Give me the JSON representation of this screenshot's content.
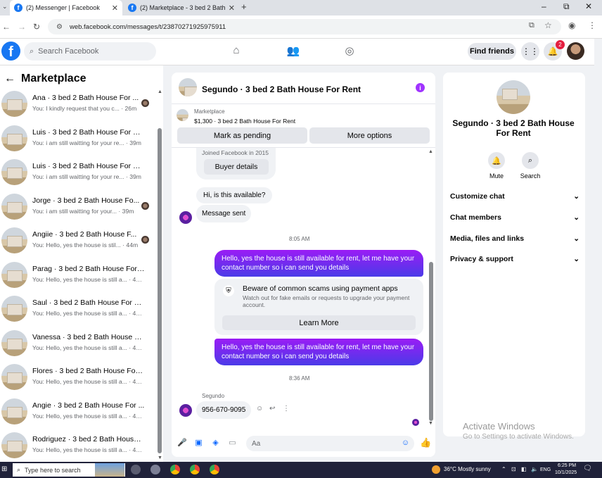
{
  "browser": {
    "tabs": [
      {
        "title": "(2) Messenger | Facebook",
        "active": true
      },
      {
        "title": "(2) Marketplace - 3 bed 2 Bath",
        "active": false
      }
    ],
    "url": "web.facebook.com/messages/t/23870271925975911",
    "window_controls": {
      "minimize": "–",
      "restore": "⧉",
      "close": "✕"
    }
  },
  "header": {
    "logo": "f",
    "search_placeholder": "Search Facebook",
    "find_friends_label": "Find friends",
    "notifications_count": "2"
  },
  "sidebar": {
    "title": "Marketplace",
    "conversations": [
      {
        "name": "Ana · 3 bed 2 Bath House For ...",
        "preview": "You: I kindly request that you c... · 26m"
      },
      {
        "name": "Luis · 3 bed 2 Bath House For Re...",
        "preview": "You: i am still waitting for your re... · 39m"
      },
      {
        "name": "Luis · 3 bed 2 Bath House For Re...",
        "preview": "You: i am still waitting for your re... · 39m"
      },
      {
        "name": "Jorge · 3 bed 2 Bath House Fo...",
        "preview": "You: i am still waitting for your... · 39m"
      },
      {
        "name": "Angiie · 3 bed 2 Bath House F...",
        "preview": "You: Hello, yes the house is stil... · 44m"
      },
      {
        "name": "Parag · 3 bed 2 Bath House For ...",
        "preview": "You: Hello, yes the house is still a... · 47m"
      },
      {
        "name": "Saul · 3 bed 2 Bath House For R...",
        "preview": "You: Hello, yes the house is still a... · 47m"
      },
      {
        "name": "Vanessa · 3 bed 2 Bath House Fo...",
        "preview": "You: Hello, yes the house is still a... · 47m"
      },
      {
        "name": "Flores · 3 bed 2 Bath House For ...",
        "preview": "You: Hello, yes the house is still a... · 47m"
      },
      {
        "name": "Angie · 3 bed 2 Bath House For ...",
        "preview": "You: Hello, yes the house is still a... · 47m"
      },
      {
        "name": "Rodriguez · 3 bed 2 Bath House ...",
        "preview": "You: Hello, yes the house is still a... · 48m"
      }
    ]
  },
  "chat": {
    "title": "Segundo · 3 bed 2 Bath House For Rent",
    "marketplace_label": "Marketplace",
    "listing": "$1,300 · 3 bed 2 Bath House For Rent",
    "mark_pending_label": "Mark as pending",
    "more_options_label": "More options",
    "joined_text": "Joined Facebook in 2015",
    "buyer_details_label": "Buyer details",
    "msg_available": "Hi, is this available?",
    "msg_sent": "Message sent",
    "time1": "8:05 AM",
    "reply1": "Hello, yes the house is still available for rent, let me have your contact number so i can send you  details",
    "scam_title": "Beware of common scams using payment apps",
    "scam_text": "Watch out for fake emails or requests to upgrade your payment account.",
    "learn_more_label": "Learn More",
    "reply2": "Hello, yes the house is still available for rent, let me have your contact number so i can send you  details",
    "time2": "8:36 AM",
    "sender_name": "Segundo",
    "phone_msg": "956-670-9095",
    "composer_placeholder": "Aa"
  },
  "details": {
    "name": "Segundo · 3 bed 2 Bath House For Rent",
    "mute_label": "Mute",
    "search_label": "Search",
    "options": [
      "Customize chat",
      "Chat members",
      "Media, files and links",
      "Privacy & support"
    ]
  },
  "watermark": {
    "line1": "Activate Windows",
    "line2": "Go to Settings to activate Windows."
  },
  "taskbar": {
    "search_placeholder": "Type here to search",
    "weather": "36°C  Mostly sunny",
    "lang": "ENG",
    "time": "6:25 PM",
    "date": "10/1/2025"
  }
}
